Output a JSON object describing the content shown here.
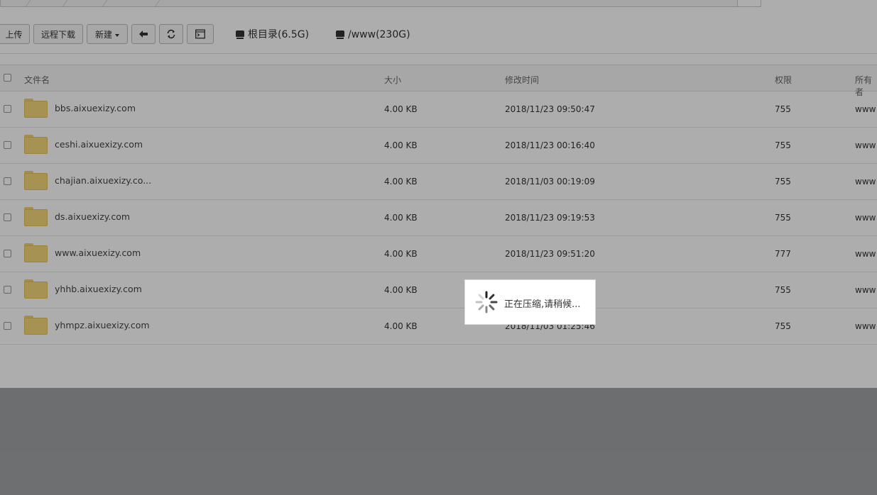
{
  "toolbar": {
    "upload_label": "上传",
    "remote_download_label": "远程下载",
    "new_label": "新建",
    "disks": [
      {
        "label": "根目录(6.5G)"
      },
      {
        "label": "/www(230G)"
      }
    ]
  },
  "table": {
    "headers": {
      "name": "文件名",
      "size": "大小",
      "modified": "修改时间",
      "permissions": "权限",
      "owner": "所有者"
    },
    "rows": [
      {
        "name": "bbs.aixuexizy.com",
        "size": "4.00 KB",
        "modified": "2018/11/23 09:50:47",
        "perm": "755",
        "owner": "www"
      },
      {
        "name": "ceshi.aixuexizy.com",
        "size": "4.00 KB",
        "modified": "2018/11/23 00:16:40",
        "perm": "755",
        "owner": "www"
      },
      {
        "name": "chajian.aixuexizy.co...",
        "size": "4.00 KB",
        "modified": "2018/11/03 00:19:09",
        "perm": "755",
        "owner": "www"
      },
      {
        "name": "ds.aixuexizy.com",
        "size": "4.00 KB",
        "modified": "2018/11/23 09:19:53",
        "perm": "755",
        "owner": "www"
      },
      {
        "name": "www.aixuexizy.com",
        "size": "4.00 KB",
        "modified": "2018/11/23 09:51:20",
        "perm": "777",
        "owner": "www"
      },
      {
        "name": "yhhb.aixuexizy.com",
        "size": "4.00 KB",
        "modified": "",
        "perm": "755",
        "owner": "www"
      },
      {
        "name": "yhmpz.aixuexizy.com",
        "size": "4.00 KB",
        "modified": "2018/11/03 01:25:46",
        "perm": "755",
        "owner": "www"
      }
    ]
  },
  "loading": {
    "message": "正在压缩,请稍候..."
  }
}
